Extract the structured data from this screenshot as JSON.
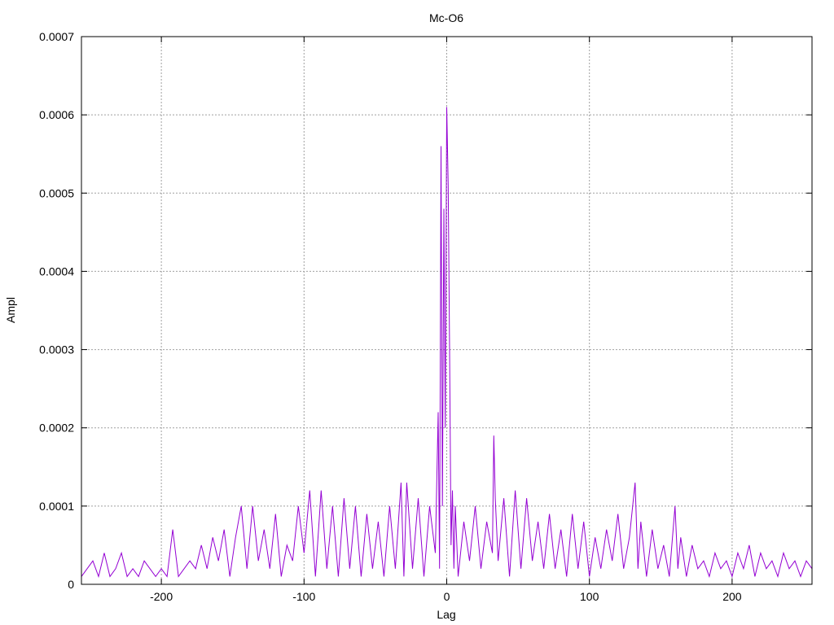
{
  "chart_data": {
    "type": "line",
    "title": "Mc-O6",
    "xlabel": "Lag",
    "ylabel": "Ampl",
    "xlim": [
      -256,
      256
    ],
    "ylim": [
      0,
      0.0007
    ],
    "x_ticks": [
      -200,
      -100,
      0,
      100,
      200
    ],
    "x_tick_labels": [
      "-200",
      "-100",
      "0",
      "100",
      "200"
    ],
    "y_ticks": [
      0,
      0.0001,
      0.0002,
      0.0003,
      0.0004,
      0.0005,
      0.0006,
      0.0007
    ],
    "y_tick_labels": [
      "0",
      "0.0001",
      "0.0002",
      "0.0003",
      "0.0004",
      "0.0005",
      "0.0006",
      "0.0007"
    ],
    "grid": true,
    "series": [
      {
        "color": "#9400d3",
        "x": [
          -256,
          -252,
          -248,
          -244,
          -240,
          -236,
          -232,
          -228,
          -224,
          -220,
          -216,
          -212,
          -208,
          -204,
          -200,
          -196,
          -192,
          -188,
          -184,
          -180,
          -176,
          -172,
          -168,
          -164,
          -160,
          -156,
          -152,
          -148,
          -144,
          -140,
          -136,
          -132,
          -128,
          -124,
          -120,
          -116,
          -112,
          -108,
          -104,
          -100,
          -96,
          -92,
          -88,
          -84,
          -80,
          -76,
          -72,
          -68,
          -64,
          -60,
          -56,
          -52,
          -48,
          -44,
          -40,
          -36,
          -32,
          -30,
          -28,
          -24,
          -20,
          -16,
          -12,
          -8,
          -6,
          -5,
          -4,
          -3,
          -2,
          -1,
          0,
          1,
          2,
          3,
          4,
          5,
          6,
          8,
          12,
          16,
          20,
          24,
          28,
          32,
          33,
          34,
          36,
          40,
          44,
          48,
          52,
          56,
          60,
          64,
          68,
          72,
          76,
          80,
          84,
          88,
          92,
          96,
          100,
          104,
          108,
          112,
          116,
          120,
          124,
          128,
          132,
          134,
          136,
          140,
          144,
          148,
          152,
          156,
          160,
          162,
          164,
          168,
          172,
          176,
          180,
          184,
          188,
          192,
          196,
          200,
          204,
          208,
          212,
          216,
          220,
          224,
          228,
          232,
          236,
          240,
          244,
          248,
          252,
          256
        ],
        "y": [
          1e-05,
          2e-05,
          3e-05,
          1e-05,
          4e-05,
          1e-05,
          2e-05,
          4e-05,
          1e-05,
          2e-05,
          1e-05,
          3e-05,
          2e-05,
          1e-05,
          2e-05,
          1e-05,
          7e-05,
          1e-05,
          2e-05,
          3e-05,
          2e-05,
          5e-05,
          2e-05,
          6e-05,
          3e-05,
          7e-05,
          1e-05,
          6e-05,
          0.0001,
          2e-05,
          0.0001,
          3e-05,
          7e-05,
          2e-05,
          9e-05,
          1e-05,
          5e-05,
          3e-05,
          0.0001,
          4e-05,
          0.00012,
          1e-05,
          0.00012,
          2e-05,
          0.0001,
          1e-05,
          0.00011,
          2e-05,
          0.0001,
          1e-05,
          9e-05,
          2e-05,
          8e-05,
          1e-05,
          0.0001,
          2e-05,
          0.00013,
          1e-05,
          0.00013,
          2e-05,
          0.00011,
          1e-05,
          0.0001,
          4e-05,
          0.00022,
          2e-05,
          0.00056,
          0.0001,
          0.00048,
          0.0002,
          0.00061,
          0.00051,
          0.0003,
          5e-05,
          0.00012,
          2e-05,
          0.0001,
          1e-05,
          8e-05,
          3e-05,
          0.0001,
          2e-05,
          8e-05,
          4e-05,
          0.00019,
          0.00011,
          3e-05,
          0.00011,
          1e-05,
          0.00012,
          2e-05,
          0.00011,
          3e-05,
          8e-05,
          2e-05,
          9e-05,
          2e-05,
          7e-05,
          1e-05,
          9e-05,
          2e-05,
          8e-05,
          1e-05,
          6e-05,
          2e-05,
          7e-05,
          3e-05,
          9e-05,
          2e-05,
          6e-05,
          0.00013,
          2e-05,
          8e-05,
          1e-05,
          7e-05,
          2e-05,
          5e-05,
          1e-05,
          0.0001,
          2e-05,
          6e-05,
          1e-05,
          5e-05,
          2e-05,
          3e-05,
          1e-05,
          4e-05,
          2e-05,
          3e-05,
          1e-05,
          4e-05,
          2e-05,
          5e-05,
          1e-05,
          4e-05,
          2e-05,
          3e-05,
          1e-05,
          4e-05,
          2e-05,
          3e-05,
          1e-05,
          3e-05,
          2e-05
        ]
      }
    ]
  }
}
